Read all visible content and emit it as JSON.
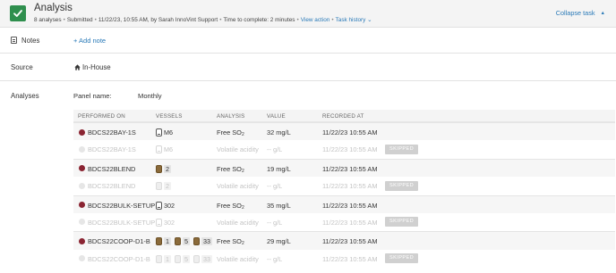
{
  "header": {
    "title": "Analysis",
    "analyses_count": "8 analyses",
    "status": "Submitted",
    "submitted_info": "11/22/23, 10:55 AM, by Sarah InnoVint Support",
    "time_to_complete": "Time to complete: 2 minutes",
    "view_action": "View action",
    "task_history": "Task history",
    "task_history_caret": "⌄",
    "collapse_label": "Collapse task",
    "collapse_caret": "▲",
    "check_color": "#2f8f4e"
  },
  "notes": {
    "label": "Notes",
    "add_label": "+ Add note"
  },
  "source": {
    "label": "Source",
    "value": "In-House"
  },
  "analyses": {
    "label": "Analyses",
    "panel_label": "Panel name:",
    "panel_value": "Monthly",
    "columns": [
      "PERFORMED ON",
      "VESSELS",
      "ANALYSIS",
      "VALUE",
      "RECORDED AT"
    ],
    "skipped_label": "SKIPPED",
    "rows": [
      {
        "performed_on": "BDCS22BAY-1S",
        "vessels": [
          {
            "type": "tank",
            "label": "M6"
          }
        ],
        "analysis": "Free SO",
        "analysis_sub": "2",
        "value": "32 mg/L",
        "recorded_at": "11/22/23 10:55 AM",
        "skipped": false
      },
      {
        "performed_on": "BDCS22BAY-1S",
        "vessels": [
          {
            "type": "tank",
            "label": "M6"
          }
        ],
        "analysis": "Volatile acidity",
        "analysis_sub": "",
        "value": "-- g/L",
        "recorded_at": "11/22/23 10:55 AM",
        "skipped": true
      },
      {
        "performed_on": "BDCS22BLEND",
        "vessels": [
          {
            "type": "barrel",
            "label": "2"
          }
        ],
        "analysis": "Free SO",
        "analysis_sub": "2",
        "value": "19 mg/L",
        "recorded_at": "11/22/23 10:55 AM",
        "skipped": false
      },
      {
        "performed_on": "BDCS22BLEND",
        "vessels": [
          {
            "type": "barrel",
            "label": "2"
          }
        ],
        "analysis": "Volatile acidity",
        "analysis_sub": "",
        "value": "-- g/L",
        "recorded_at": "11/22/23 10:55 AM",
        "skipped": true
      },
      {
        "performed_on": "BDCS22BULK-SETUP",
        "vessels": [
          {
            "type": "tank",
            "label": "302"
          }
        ],
        "analysis": "Free SO",
        "analysis_sub": "2",
        "value": "35 mg/L",
        "recorded_at": "11/22/23 10:55 AM",
        "skipped": false
      },
      {
        "performed_on": "BDCS22BULK-SETUP",
        "vessels": [
          {
            "type": "tank",
            "label": "302"
          }
        ],
        "analysis": "Volatile acidity",
        "analysis_sub": "",
        "value": "-- g/L",
        "recorded_at": "11/22/23 10:55 AM",
        "skipped": true
      },
      {
        "performed_on": "BDCS22COOP-D1-B",
        "vessels": [
          {
            "type": "barrel",
            "label": "1"
          },
          {
            "type": "barrel",
            "label": "5"
          },
          {
            "type": "barrel",
            "label": "33"
          }
        ],
        "analysis": "Free SO",
        "analysis_sub": "2",
        "value": "29 mg/L",
        "recorded_at": "11/22/23 10:55 AM",
        "skipped": false
      },
      {
        "performed_on": "BDCS22COOP-D1-B",
        "vessels": [
          {
            "type": "barrel",
            "label": "1"
          },
          {
            "type": "barrel",
            "label": "5"
          },
          {
            "type": "barrel",
            "label": "33"
          }
        ],
        "analysis": "Volatile acidity",
        "analysis_sub": "",
        "value": "-- g/L",
        "recorded_at": "11/22/23 10:55 AM",
        "skipped": true
      }
    ]
  }
}
